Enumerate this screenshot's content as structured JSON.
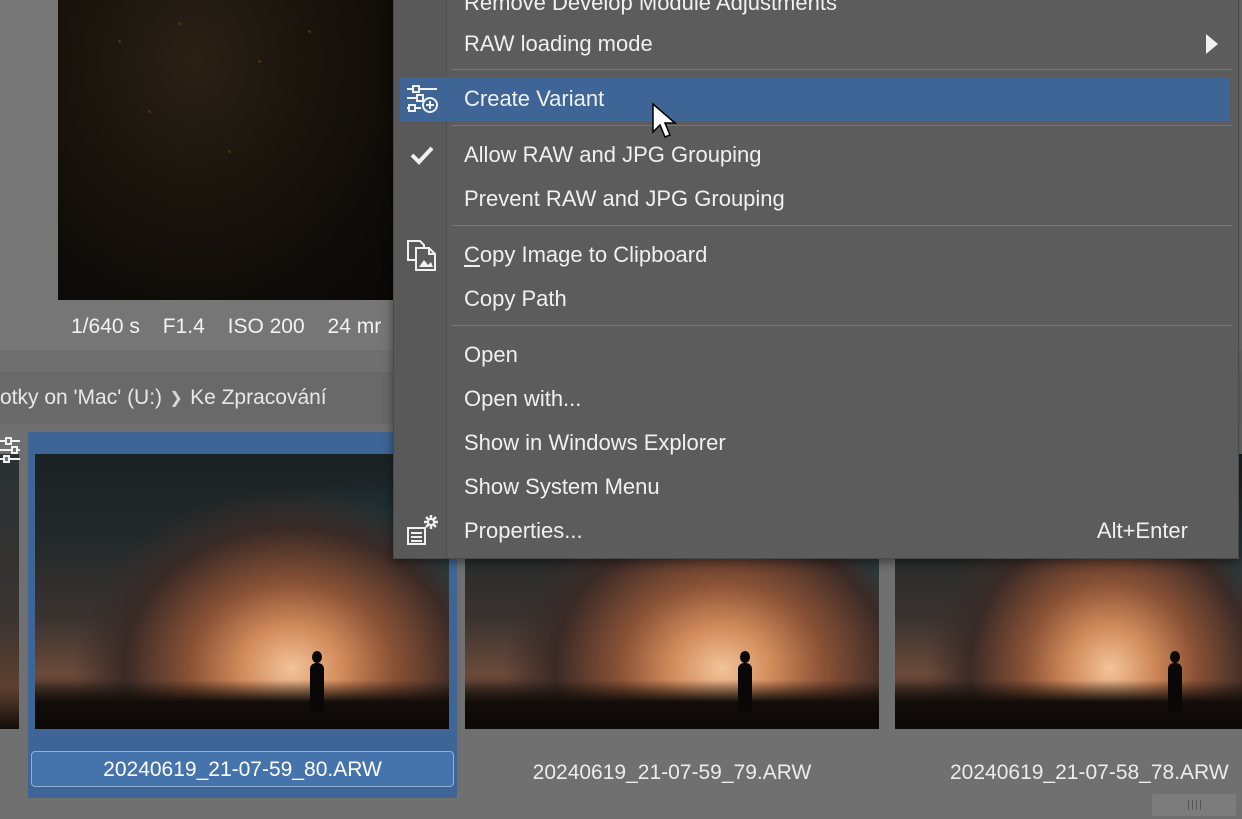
{
  "preview": {
    "exif": [
      "1/640 s",
      "F1.4",
      "ISO 200",
      "24 mr"
    ]
  },
  "breadcrumb": {
    "items": [
      "otky on 'Mac' (U:)",
      "Ke Zpracování"
    ]
  },
  "filmstrip": {
    "thumbnails": [
      {
        "filename": "20240619_21-07-59_80.ARW",
        "selected": true
      },
      {
        "filename": "20240619_21-07-59_79.ARW",
        "selected": false
      },
      {
        "filename": "20240619_21-07-58_78.ARW",
        "selected": false
      }
    ]
  },
  "menu": {
    "partial_top_label": "Remove Develop Module Adjustments",
    "raw_loading_mode": "RAW loading mode",
    "create_variant": "Create Variant",
    "allow_grouping": "Allow RAW and JPG Grouping",
    "prevent_grouping": "Prevent RAW and JPG Grouping",
    "copy_image_first": "C",
    "copy_image_rest": "opy Image to Clipboard",
    "copy_path": "Copy Path",
    "open": "Open",
    "open_with": "Open with...",
    "show_explorer": "Show in Windows Explorer",
    "show_system_menu": "Show System Menu",
    "properties": "Properties...",
    "properties_shortcut": "Alt+Enter",
    "hovered_item": "Create Variant",
    "checked_item": "Allow RAW and JPG Grouping"
  },
  "colors": {
    "highlight": "#3f6597",
    "menu_bg": "#5c5c5c",
    "selected_name_bg": "#4574ad"
  },
  "icons": [
    "variant-icon",
    "checkmark-icon",
    "copy-image-icon",
    "properties-icon",
    "submenu-arrow-icon",
    "mouse-cursor-icon"
  ]
}
